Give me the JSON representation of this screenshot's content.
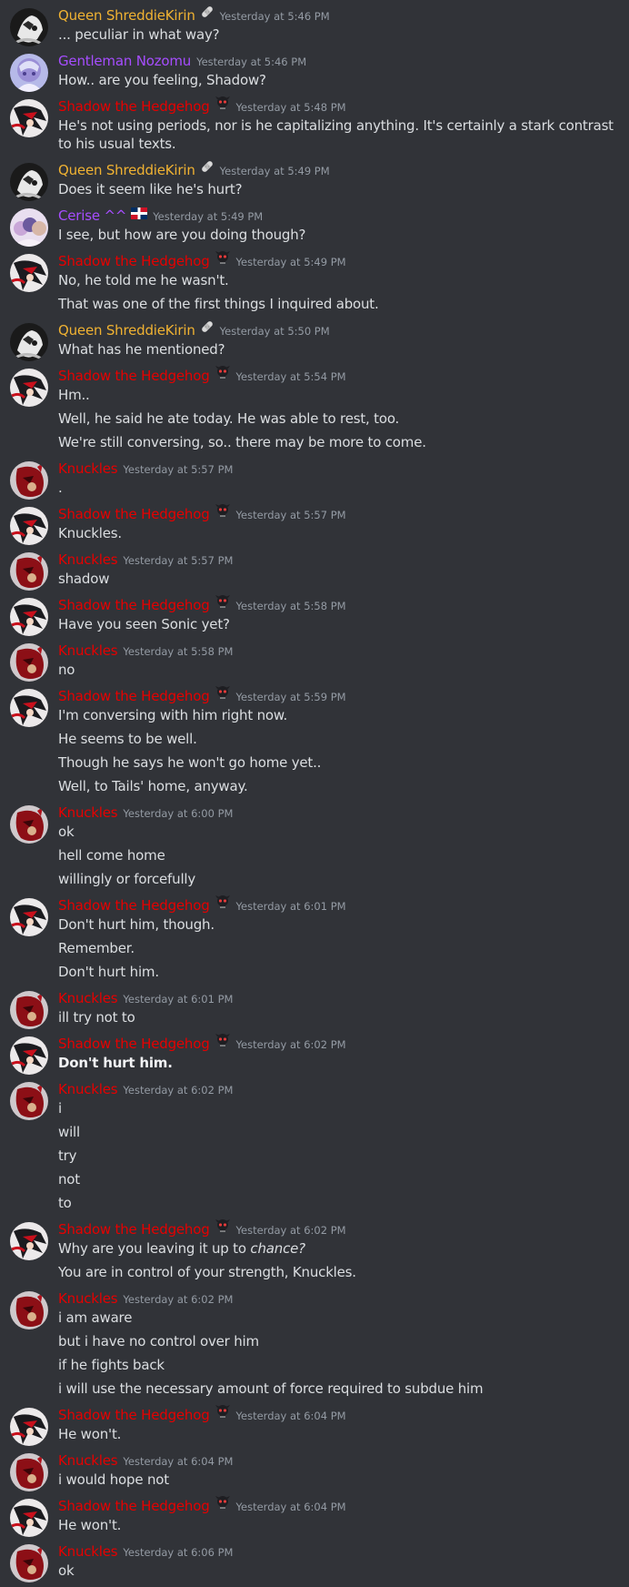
{
  "colors": {
    "background": "#313338",
    "text": "#dbdee1",
    "timestamp": "#949ba4",
    "queen": "#f0b232",
    "gentleman": "#a64dff",
    "cerise": "#a64dff",
    "shadow": "#e60000",
    "knuckles": "#e60000"
  },
  "messages": [
    {
      "author": "Queen ShreddieKirin",
      "badge": "bandage-icon",
      "timestamp": "Yesterday at 5:46 PM",
      "lines": [
        "... peculiar in what way?"
      ]
    },
    {
      "author": "Gentleman Nozomu",
      "badge": "",
      "timestamp": "Yesterday at 5:46 PM",
      "lines": [
        "How.. are you feeling, Shadow?"
      ]
    },
    {
      "author": "Shadow the Hedgehog",
      "badge": "skull-icon",
      "timestamp": "Yesterday at 5:48 PM",
      "lines": [
        "He's not using periods, nor is he capitalizing anything. It's certainly a stark contrast to his usual texts."
      ]
    },
    {
      "author": "Queen ShreddieKirin",
      "badge": "bandage-icon",
      "timestamp": "Yesterday at 5:49 PM",
      "lines": [
        "Does it seem like he's hurt?"
      ]
    },
    {
      "author": "Cerise ^^",
      "badge": "flag-icon",
      "timestamp": "Yesterday at 5:49 PM",
      "lines": [
        "I see, but how are you doing though?"
      ]
    },
    {
      "author": "Shadow the Hedgehog",
      "badge": "skull-icon",
      "timestamp": "Yesterday at 5:49 PM",
      "lines": [
        "No, he told me he wasn't.",
        "That was one of the first things I inquired about."
      ]
    },
    {
      "author": "Queen ShreddieKirin",
      "badge": "bandage-icon",
      "timestamp": "Yesterday at 5:50 PM",
      "lines": [
        "What has he mentioned?"
      ]
    },
    {
      "author": "Shadow the Hedgehog",
      "badge": "skull-icon",
      "timestamp": "Yesterday at 5:54 PM",
      "lines": [
        "Hm..",
        "Well, he said he ate today. He was able to rest, too.",
        "We're still conversing, so.. there may be more to come."
      ]
    },
    {
      "author": "Knuckles",
      "badge": "",
      "timestamp": "Yesterday at 5:57 PM",
      "lines": [
        "."
      ]
    },
    {
      "author": "Shadow the Hedgehog",
      "badge": "skull-icon",
      "timestamp": "Yesterday at 5:57 PM",
      "lines": [
        "Knuckles."
      ]
    },
    {
      "author": "Knuckles",
      "badge": "",
      "timestamp": "Yesterday at 5:57 PM",
      "lines": [
        "shadow"
      ]
    },
    {
      "author": "Shadow the Hedgehog",
      "badge": "skull-icon",
      "timestamp": "Yesterday at 5:58 PM",
      "lines": [
        "Have you seen Sonic yet?"
      ]
    },
    {
      "author": "Knuckles",
      "badge": "",
      "timestamp": "Yesterday at 5:58 PM",
      "lines": [
        "no"
      ]
    },
    {
      "author": "Shadow the Hedgehog",
      "badge": "skull-icon",
      "timestamp": "Yesterday at 5:59 PM",
      "lines": [
        "I'm conversing with him right now.",
        "He seems to be well.",
        "Though he says he won't go home yet..",
        "Well, to Tails' home, anyway."
      ]
    },
    {
      "author": "Knuckles",
      "badge": "",
      "timestamp": "Yesterday at 6:00 PM",
      "lines": [
        "ok",
        "hell come home",
        "willingly or forcefully"
      ]
    },
    {
      "author": "Shadow the Hedgehog",
      "badge": "skull-icon",
      "timestamp": "Yesterday at 6:01 PM",
      "lines": [
        "Don't hurt him, though.",
        "Remember.",
        "Don't hurt him."
      ]
    },
    {
      "author": "Knuckles",
      "badge": "",
      "timestamp": "Yesterday at 6:01 PM",
      "lines": [
        "ill try not to"
      ]
    },
    {
      "author": "Shadow the Hedgehog",
      "badge": "skull-icon",
      "timestamp": "Yesterday at 6:02 PM",
      "bold": true,
      "lines": [
        "Don't hurt him."
      ]
    },
    {
      "author": "Knuckles",
      "badge": "",
      "timestamp": "Yesterday at 6:02 PM",
      "lines": [
        "i",
        "will",
        "try",
        "not",
        "to"
      ]
    },
    {
      "author": "Shadow the Hedgehog",
      "badge": "skull-icon",
      "timestamp": "Yesterday at 6:02 PM",
      "lines": [
        "Why are you leaving it up to ",
        "You are in control of your strength, Knuckles."
      ],
      "italic_tail": "chance?"
    },
    {
      "author": "Knuckles",
      "badge": "",
      "timestamp": "Yesterday at 6:02 PM",
      "lines": [
        "i am aware",
        "but i have no control over him",
        "if he fights back",
        "i will use the necessary amount of force required to subdue him"
      ]
    },
    {
      "author": "Shadow the Hedgehog",
      "badge": "skull-icon",
      "timestamp": "Yesterday at 6:04 PM",
      "lines": [
        "He won't."
      ]
    },
    {
      "author": "Knuckles",
      "badge": "",
      "timestamp": "Yesterday at 6:04 PM",
      "lines": [
        "i would hope not"
      ]
    },
    {
      "author": "Shadow the Hedgehog",
      "badge": "skull-icon",
      "timestamp": "Yesterday at 6:04 PM",
      "lines": [
        "He won't."
      ]
    },
    {
      "author": "Knuckles",
      "badge": "",
      "timestamp": "Yesterday at 6:06 PM",
      "lines": [
        "ok"
      ]
    }
  ]
}
